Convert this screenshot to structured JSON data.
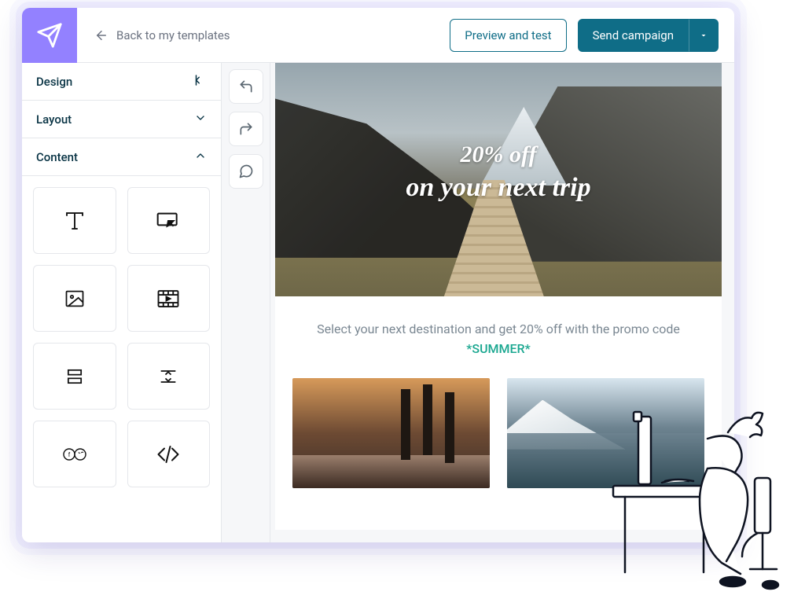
{
  "topbar": {
    "back_label": "Back to my templates",
    "preview_label": "Preview and test",
    "send_label": "Send campaign"
  },
  "sidebar": {
    "sections": {
      "design": "Design",
      "layout": "Layout",
      "content": "Content"
    },
    "content_blocks": [
      "text",
      "button",
      "image",
      "video",
      "spacer",
      "divider",
      "social",
      "html"
    ]
  },
  "email": {
    "hero_line1": "20% off",
    "hero_line2": "on your next trip",
    "body_lead": "Select your next destination and get 20% off with the promo code ",
    "promo_code": "*SUMMER*"
  },
  "colors": {
    "brand_purple": "#9381ff",
    "brand_teal": "#0f6d87",
    "promo_green": "#1aa790"
  }
}
